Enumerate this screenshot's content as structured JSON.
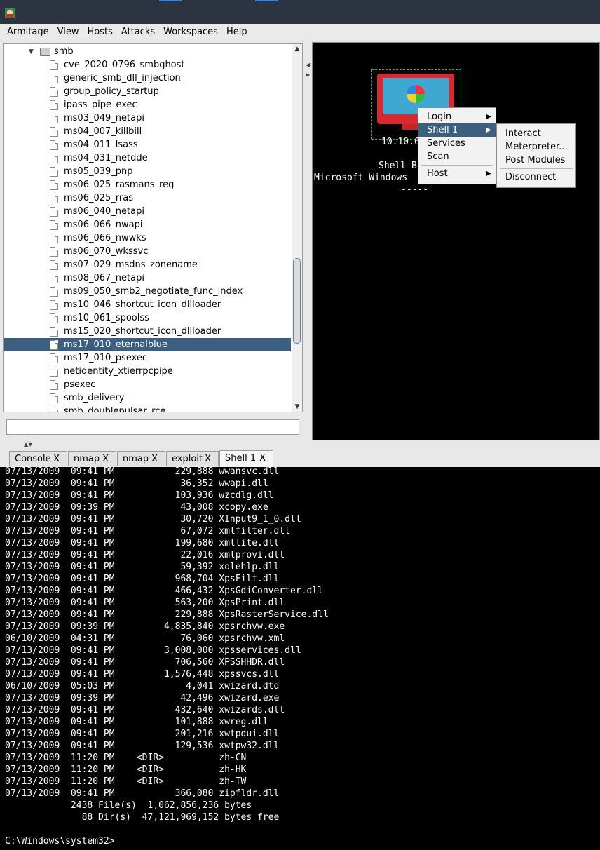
{
  "menu": [
    "Armitage",
    "View",
    "Hosts",
    "Attacks",
    "Workspaces",
    "Help"
  ],
  "tree": {
    "folder": "smb",
    "items": [
      "cve_2020_0796_smbghost",
      "generic_smb_dll_injection",
      "group_policy_startup",
      "ipass_pipe_exec",
      "ms03_049_netapi",
      "ms04_007_killbill",
      "ms04_011_lsass",
      "ms04_031_netdde",
      "ms05_039_pnp",
      "ms06_025_rasmans_reg",
      "ms06_025_rras",
      "ms06_040_netapi",
      "ms06_066_nwapi",
      "ms06_066_nwwks",
      "ms06_070_wkssvc",
      "ms07_029_msdns_zonename",
      "ms08_067_netapi",
      "ms09_050_smb2_negotiate_func_index",
      "ms10_046_shortcut_icon_dllloader",
      "ms10_061_spoolss",
      "ms15_020_shortcut_icon_dllloader",
      "ms17_010_eternalblue",
      "ms17_010_psexec",
      "netidentity_xtierrpcpipe",
      "psexec",
      "smb_delivery",
      "smb_doublepulsar_rce"
    ],
    "selected_index": 21
  },
  "graph": {
    "host_ip": "10.10.6",
    "label_line1": "Shell B",
    "label_line2": "Microsoft Windows",
    "label_line3": "-----"
  },
  "context_menu": {
    "items": [
      "Login",
      "Shell 1",
      "Services",
      "Scan",
      "Host"
    ],
    "highlighted": "Shell 1"
  },
  "submenu": {
    "items": [
      "Interact",
      "Meterpreter...",
      "Post Modules",
      "Disconnect"
    ]
  },
  "tabs": [
    {
      "label": "Console",
      "close": "X"
    },
    {
      "label": "nmap",
      "close": "X"
    },
    {
      "label": "nmap",
      "close": "X"
    },
    {
      "label": "exploit",
      "close": "X"
    },
    {
      "label": "Shell 1",
      "close": "X"
    }
  ],
  "active_tab": "Shell 1",
  "console_lines": [
    "07/13/2009  09:41 PM           229,888 wwansvc.dll",
    "07/13/2009  09:41 PM            36,352 wwapi.dll",
    "07/13/2009  09:41 PM           103,936 wzcdlg.dll",
    "07/13/2009  09:39 PM            43,008 xcopy.exe",
    "07/13/2009  09:41 PM            30,720 XInput9_1_0.dll",
    "07/13/2009  09:41 PM            67,072 xmlfilter.dll",
    "07/13/2009  09:41 PM           199,680 xmllite.dll",
    "07/13/2009  09:41 PM            22,016 xmlprovi.dll",
    "07/13/2009  09:41 PM            59,392 xolehlp.dll",
    "07/13/2009  09:41 PM           968,704 XpsFilt.dll",
    "07/13/2009  09:41 PM           466,432 XpsGdiConverter.dll",
    "07/13/2009  09:41 PM           563,200 XpsPrint.dll",
    "07/13/2009  09:41 PM           229,888 XpsRasterService.dll",
    "07/13/2009  09:39 PM         4,835,840 xpsrchvw.exe",
    "06/10/2009  04:31 PM            76,060 xpsrchvw.xml",
    "07/13/2009  09:41 PM         3,008,000 xpsservices.dll",
    "07/13/2009  09:41 PM           706,560 XPSSHHDR.dll",
    "07/13/2009  09:41 PM         1,576,448 xpssvcs.dll",
    "06/10/2009  05:03 PM             4,041 xwizard.dtd",
    "07/13/2009  09:39 PM            42,496 xwizard.exe",
    "07/13/2009  09:41 PM           432,640 xwizards.dll",
    "07/13/2009  09:41 PM           101,888 xwreg.dll",
    "07/13/2009  09:41 PM           201,216 xwtpdui.dll",
    "07/13/2009  09:41 PM           129,536 xwtpw32.dll",
    "07/13/2009  11:20 PM    <DIR>          zh-CN",
    "07/13/2009  11:20 PM    <DIR>          zh-HK",
    "07/13/2009  11:20 PM    <DIR>          zh-TW",
    "07/13/2009  09:41 PM           366,080 zipfldr.dll",
    "            2438 File(s)  1,062,856,236 bytes",
    "              88 Dir(s)  47,121,969,152 bytes free",
    "",
    "C:\\Windows\\system32>"
  ]
}
